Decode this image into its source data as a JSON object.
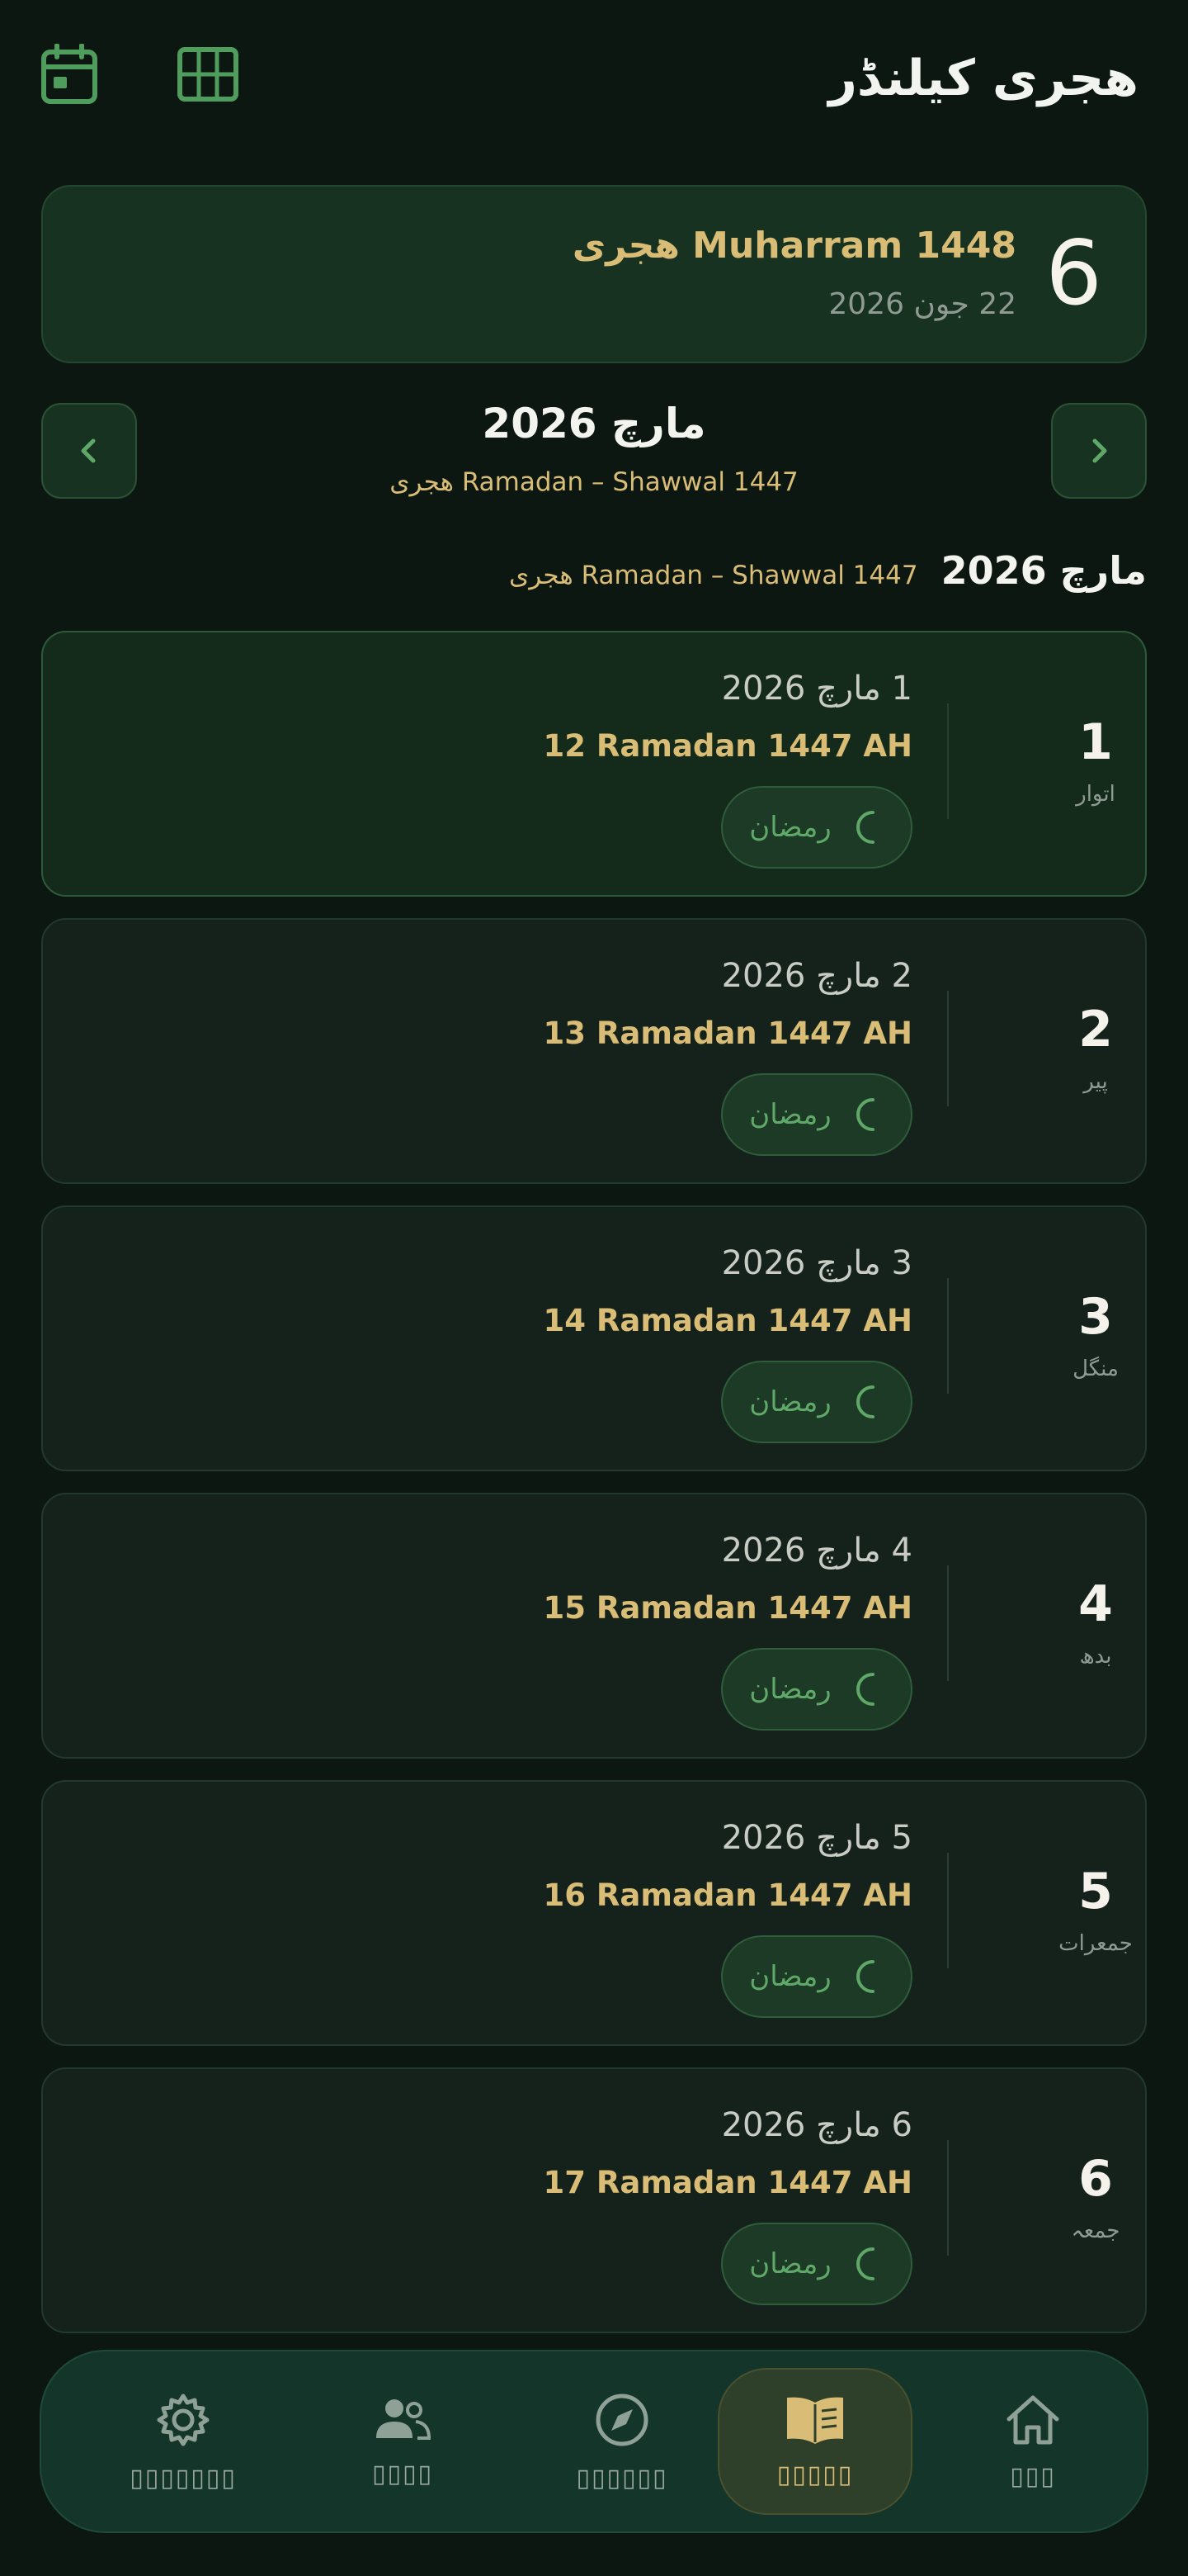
{
  "header": {
    "title": "هجری کیلنڈر",
    "icons": [
      "calendar-icon",
      "grid-icon"
    ]
  },
  "today": {
    "day_number": "6",
    "hijri": "Muharram 1448 هجری",
    "gregorian": "22 جون 2026"
  },
  "month_nav": {
    "title": "مارچ 2026",
    "subtitle": "Ramadan – Shawwal 1447 هجری"
  },
  "section": {
    "title": "مارچ 2026",
    "subtitle": "Ramadan – Shawwal 1447 هجری"
  },
  "days": [
    {
      "num": "1",
      "weekday": "اتوار",
      "gregorian": "1 مارچ 2026",
      "hijri": "12 Ramadan 1447 AH",
      "badge": "رمضان"
    },
    {
      "num": "2",
      "weekday": "پیر",
      "gregorian": "2 مارچ 2026",
      "hijri": "13 Ramadan 1447 AH",
      "badge": "رمضان"
    },
    {
      "num": "3",
      "weekday": "منگل",
      "gregorian": "3 مارچ 2026",
      "hijri": "14 Ramadan 1447 AH",
      "badge": "رمضان"
    },
    {
      "num": "4",
      "weekday": "بدھ",
      "gregorian": "4 مارچ 2026",
      "hijri": "15 Ramadan 1447 AH",
      "badge": "رمضان"
    },
    {
      "num": "5",
      "weekday": "جمعرات",
      "gregorian": "5 مارچ 2026",
      "hijri": "16 Ramadan 1447 AH",
      "badge": "رمضان"
    },
    {
      "num": "6",
      "weekday": "جمعہ",
      "gregorian": "6 مارچ 2026",
      "hijri": "17 Ramadan 1447 AH",
      "badge": "رمضان"
    }
  ],
  "bottom_nav": [
    {
      "icon": "gear-icon",
      "label": "▯▯▯▯▯▯▯"
    },
    {
      "icon": "people-icon",
      "label": "▯▯▯▯"
    },
    {
      "icon": "compass-icon",
      "label": "▯▯▯▯▯▯"
    },
    {
      "icon": "book-icon",
      "label": "▯▯▯▯▯",
      "active": true
    },
    {
      "icon": "home-icon",
      "label": "▯▯▯"
    }
  ],
  "colors": {
    "background": "#0c1712",
    "accent_gold": "#d9bd76",
    "accent_green": "#5fa868"
  }
}
